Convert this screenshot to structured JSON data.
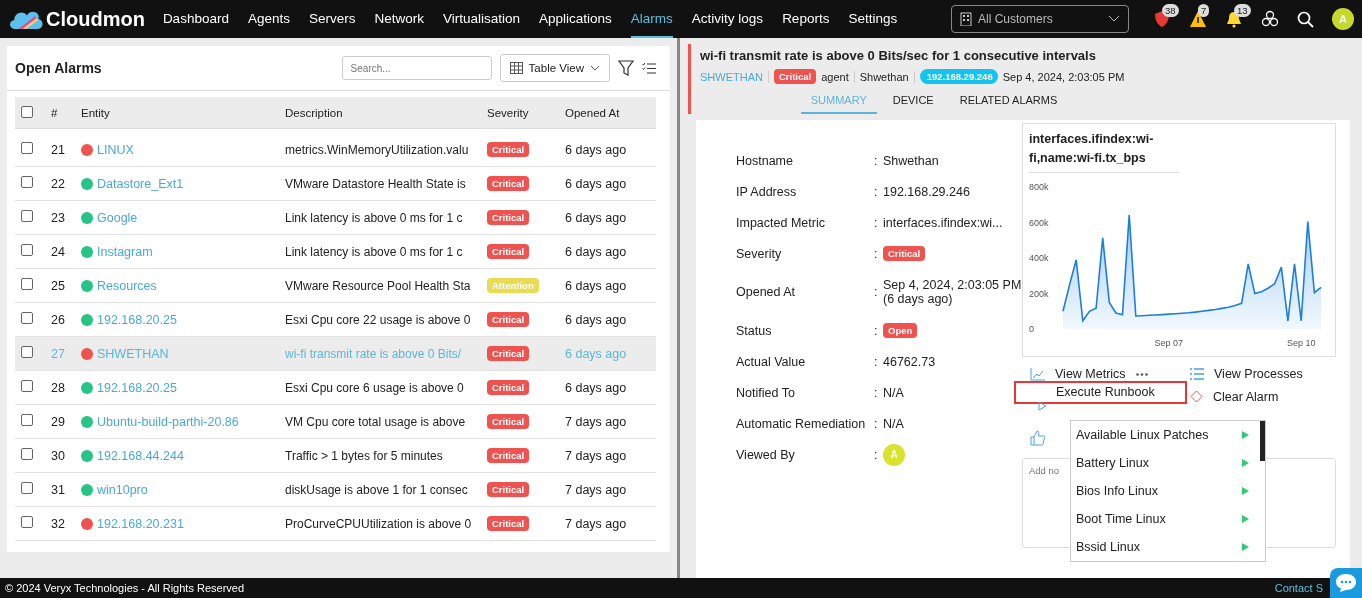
{
  "brand": "Cloudmon",
  "nav": [
    {
      "label": "Dashboard",
      "selected": false
    },
    {
      "label": "Agents",
      "selected": false
    },
    {
      "label": "Servers",
      "selected": false
    },
    {
      "label": "Network",
      "selected": false
    },
    {
      "label": "Virtualisation",
      "selected": false
    },
    {
      "label": "Applications",
      "selected": false
    },
    {
      "label": "Alarms",
      "selected": true
    },
    {
      "label": "Activity logs",
      "selected": false
    },
    {
      "label": "Reports",
      "selected": false
    },
    {
      "label": "Settings",
      "selected": false
    }
  ],
  "customer_select": {
    "value": "All Customers"
  },
  "header_icons": [
    {
      "kind": "critical",
      "count": "38"
    },
    {
      "kind": "warning",
      "count": "7"
    },
    {
      "kind": "bell",
      "count": "13"
    },
    {
      "kind": "cluster"
    },
    {
      "kind": "search"
    }
  ],
  "user_avatar": "A",
  "open_alarms": {
    "title": "Open Alarms",
    "search": {
      "placeholder": "Search..."
    },
    "view_select": "Table View",
    "select_all_checked": false,
    "columns": [
      "#",
      "Entity",
      "Description",
      "Severity",
      "Opened At"
    ],
    "rows": [
      {
        "num": "21",
        "entity": "LINUX",
        "color": "#ef5350",
        "description": "metrics.WinMemoryUtilization.valu",
        "severity": "Critical",
        "opened": "6 days ago",
        "selected": false,
        "checked": false
      },
      {
        "num": "22",
        "entity": "Datastore_Ext1",
        "color": "#26c485",
        "description": "VMware Datastore Health State is",
        "severity": "Critical",
        "opened": "6 days ago",
        "selected": false,
        "checked": false
      },
      {
        "num": "23",
        "entity": "Google",
        "color": "#26c485",
        "description": "Link latency is above 0 ms for 1 c",
        "severity": "Critical",
        "opened": "6 days ago",
        "selected": false,
        "checked": false
      },
      {
        "num": "24",
        "entity": "Instagram",
        "color": "#26c485",
        "description": "Link latency is above 0 ms for 1 c",
        "severity": "Critical",
        "opened": "6 days ago",
        "selected": false,
        "checked": false
      },
      {
        "num": "25",
        "entity": "Resources",
        "color": "#26c485",
        "description": "VMware Resource Pool Health Sta",
        "severity": "Attention",
        "opened": "6 days ago",
        "selected": false,
        "checked": false
      },
      {
        "num": "26",
        "entity": "192.168.20.25",
        "color": "#26c485",
        "description": "Esxi Cpu core 22 usage is above 0",
        "severity": "Critical",
        "opened": "6 days ago",
        "selected": false,
        "checked": false
      },
      {
        "num": "27",
        "entity": "SHWETHAN",
        "color": "#ef5350",
        "description": "wi-fi transmit rate is above 0 Bits/",
        "severity": "Critical",
        "opened": "6 days ago",
        "selected": true,
        "checked": false
      },
      {
        "num": "28",
        "entity": "192.168.20.25",
        "color": "#26c485",
        "description": "Esxi Cpu core 6 usage is above 0",
        "severity": "Critical",
        "opened": "6 days ago",
        "selected": false,
        "checked": false
      },
      {
        "num": "29",
        "entity": "Ubuntu-build-parthi-20.86",
        "color": "#26c485",
        "description": "VM Cpu core total usage is above",
        "severity": "Critical",
        "opened": "7 days ago",
        "selected": false,
        "checked": false
      },
      {
        "num": "30",
        "entity": "192.168.44.244",
        "color": "#26c485",
        "description": "Traffic > 1 bytes for 5 minutes",
        "severity": "Critical",
        "opened": "7 days ago",
        "selected": false,
        "checked": false
      },
      {
        "num": "31",
        "entity": "win10pro",
        "color": "#26c485",
        "description": "diskUsage is above 1 for 1 consec",
        "severity": "Critical",
        "opened": "7 days ago",
        "selected": false,
        "checked": false
      },
      {
        "num": "32",
        "entity": "192.168.20.231",
        "color": "#ef5350",
        "description": "ProCurveCPUUtilization is above 0",
        "severity": "Critical",
        "opened": "7 days ago",
        "selected": false,
        "checked": false
      }
    ]
  },
  "alarm_detail": {
    "title": "wi-fi transmit rate is above 0 Bits/sec for 1 consecutive intervals",
    "meta": [
      {
        "kind": "link",
        "text": "SHWETHAN"
      },
      {
        "kind": "severity",
        "text": "Critical"
      },
      {
        "kind": "text",
        "text": "agent"
      },
      {
        "kind": "text",
        "text": "Shwethan"
      },
      {
        "kind": "ip",
        "text": "192.168.29.246"
      },
      {
        "kind": "text",
        "text": "Sep 4, 2024, 2:03:05 PM"
      }
    ],
    "tabs": [
      {
        "label": "SUMMARY",
        "selected": true
      },
      {
        "label": "DEVICE",
        "selected": false
      },
      {
        "label": "RELATED ALARMS",
        "selected": false
      }
    ],
    "fields": [
      {
        "label": "Hostname",
        "separator": ":",
        "kind": "text",
        "value": "Shwethan"
      },
      {
        "label": "IP Address",
        "separator": ":",
        "kind": "text",
        "value": "192.168.29.246"
      },
      {
        "label": "Impacted Metric",
        "separator": ":",
        "kind": "text",
        "value": "interfaces.ifindex:wi..."
      },
      {
        "label": "Severity",
        "separator": ":",
        "kind": "badge",
        "value": "Critical"
      },
      {
        "label": "Opened At",
        "separator": ":",
        "kind": "text",
        "value": "Sep 4, 2024, 2:03:05 PM (6 days ago)"
      },
      {
        "label": "Status",
        "separator": ":",
        "kind": "badge",
        "value": "Open"
      },
      {
        "label": "Actual Value",
        "separator": ":",
        "kind": "text",
        "value": "46762.73"
      },
      {
        "label": "Notified To",
        "separator": ":",
        "kind": "text",
        "value": "N/A"
      },
      {
        "label": "Automatic Remediation",
        "separator": ":",
        "kind": "text",
        "value": "N/A"
      },
      {
        "label": "Viewed By",
        "separator": ":",
        "kind": "avatar",
        "value": "A"
      }
    ],
    "chart_title": "interfaces.ifindex:wi-fi,name:wi-fi.tx_bps",
    "chart_data": {
      "type": "area",
      "categories": [
        null,
        null,
        null,
        null,
        null,
        null,
        null,
        null,
        null,
        null,
        null,
        null,
        null,
        null,
        null,
        null,
        "Sep 07",
        null,
        null,
        null,
        null,
        null,
        null,
        null,
        null,
        null,
        null,
        null,
        null,
        null,
        null,
        null,
        null,
        null,
        null,
        null,
        "Sep 10",
        null,
        null,
        null
      ],
      "series": [
        {
          "color": "#1e7fd8",
          "values": [
            100000,
            250000,
            390000,
            46000,
            100000,
            117000,
            514000,
            150000,
            90000,
            80000,
            642000,
            73000,
            75000,
            77000,
            79000,
            81000,
            84000,
            86000,
            89000,
            91000,
            95000,
            100000,
            105000,
            110000,
            116000,
            123000,
            132000,
            145000,
            367000,
            200000,
            210000,
            230000,
            255000,
            349000,
            46000,
            367000,
            46000,
            605000,
            205000,
            235000
          ]
        }
      ],
      "ylim": [
        0,
        800000
      ],
      "yticks": [
        {
          "value": 0,
          "label": "0"
        },
        {
          "value": 200000,
          "label": "200k"
        },
        {
          "value": 400000,
          "label": "400k"
        },
        {
          "value": 600000,
          "label": "600k"
        },
        {
          "value": 800000,
          "label": "800k"
        }
      ]
    },
    "actions": [
      {
        "kind": "metrics",
        "label": "View Metrics"
      },
      {
        "kind": "processes",
        "label": "View Processes"
      },
      {
        "kind": "runbook",
        "label": "Execute Runbook"
      },
      {
        "kind": "clear",
        "label": "Clear Alarm"
      }
    ],
    "runbook_menu": [
      "Available Linux Patches",
      "Battery Linux",
      "Bios Info Linux",
      "Boot Time Linux",
      "Bssid Linux"
    ],
    "note": {
      "placeholder": "Add no"
    }
  },
  "footer": {
    "copyright": "© 2024 Veryx Technologies - All Rights Reserved",
    "contact": "Contact S"
  }
}
